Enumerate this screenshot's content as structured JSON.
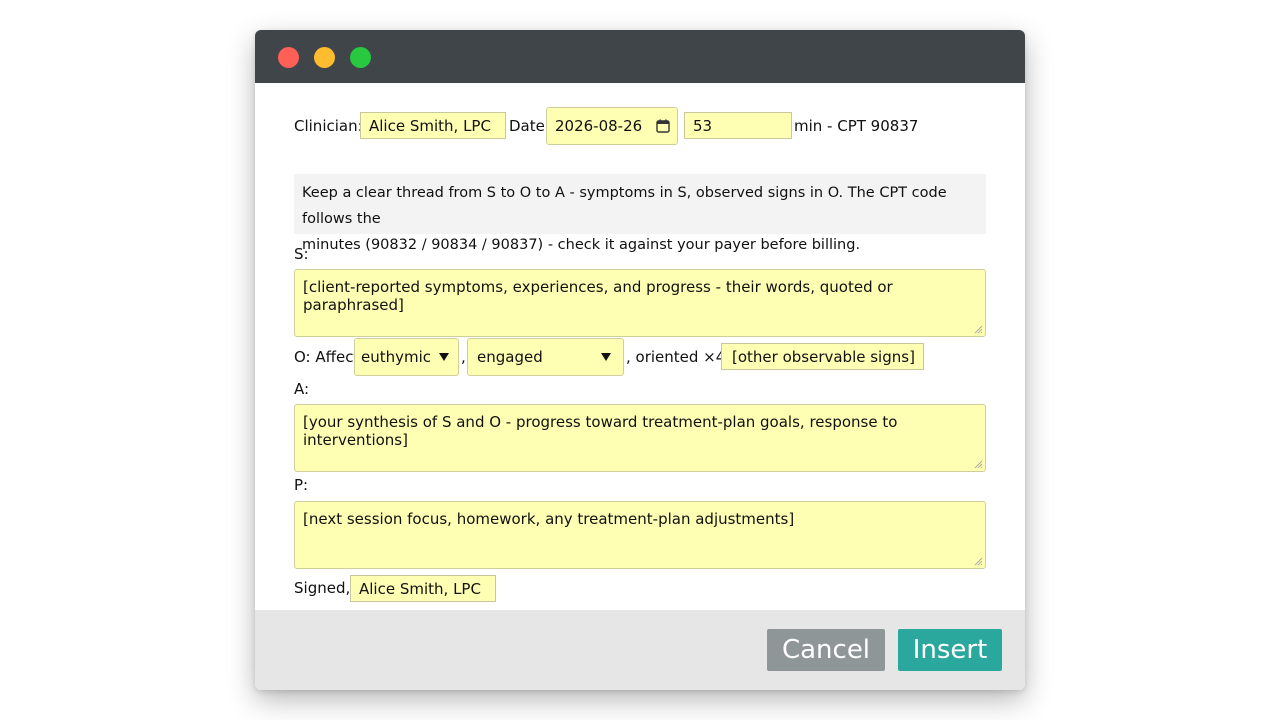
{
  "window": {
    "controls": [
      "close",
      "minimize",
      "maximize"
    ]
  },
  "header": {
    "clinician_label": "Clinician:",
    "clinician_value": "Alice Smith, LPC",
    "date_label": "Date:",
    "date_value": "2026-08-26",
    "minutes_value": "53",
    "minutes_suffix": "min - CPT 90837"
  },
  "note": {
    "line1": "Keep a clear thread from S to O to A - symptoms in S, observed signs in O. The CPT code follows the",
    "line2": "minutes (90832 / 90834 / 90837) - check it against your payer before billing."
  },
  "subjective": {
    "label": "S:",
    "value": "[client-reported symptoms, experiences, and progress - their words, quoted or paraphrased]"
  },
  "objective": {
    "label": "O: Affect",
    "affect_selected": "euthymic",
    "separator": ",",
    "engagement_selected": "engaged",
    "oriented_text": ", oriented ×4.",
    "other_value": "[other observable signs]"
  },
  "assessment": {
    "label": "A:",
    "value": "[your synthesis of S and O - progress toward treatment-plan goals, response to interventions]"
  },
  "plan": {
    "label": "P:",
    "value": "[next session focus, homework, any treatment-plan adjustments]"
  },
  "signature": {
    "label": "Signed,",
    "value": "Alice Smith, LPC"
  },
  "footer": {
    "cancel_label": "Cancel",
    "insert_label": "Insert"
  },
  "colors": {
    "titlebar": "#3f4548",
    "field_bg": "#ffffb3",
    "cancel_bg": "#8f9697",
    "insert_bg": "#2aa89e",
    "close_dot": "#fe5f57",
    "minimize_dot": "#febc2e",
    "maximize_dot": "#28c840"
  }
}
